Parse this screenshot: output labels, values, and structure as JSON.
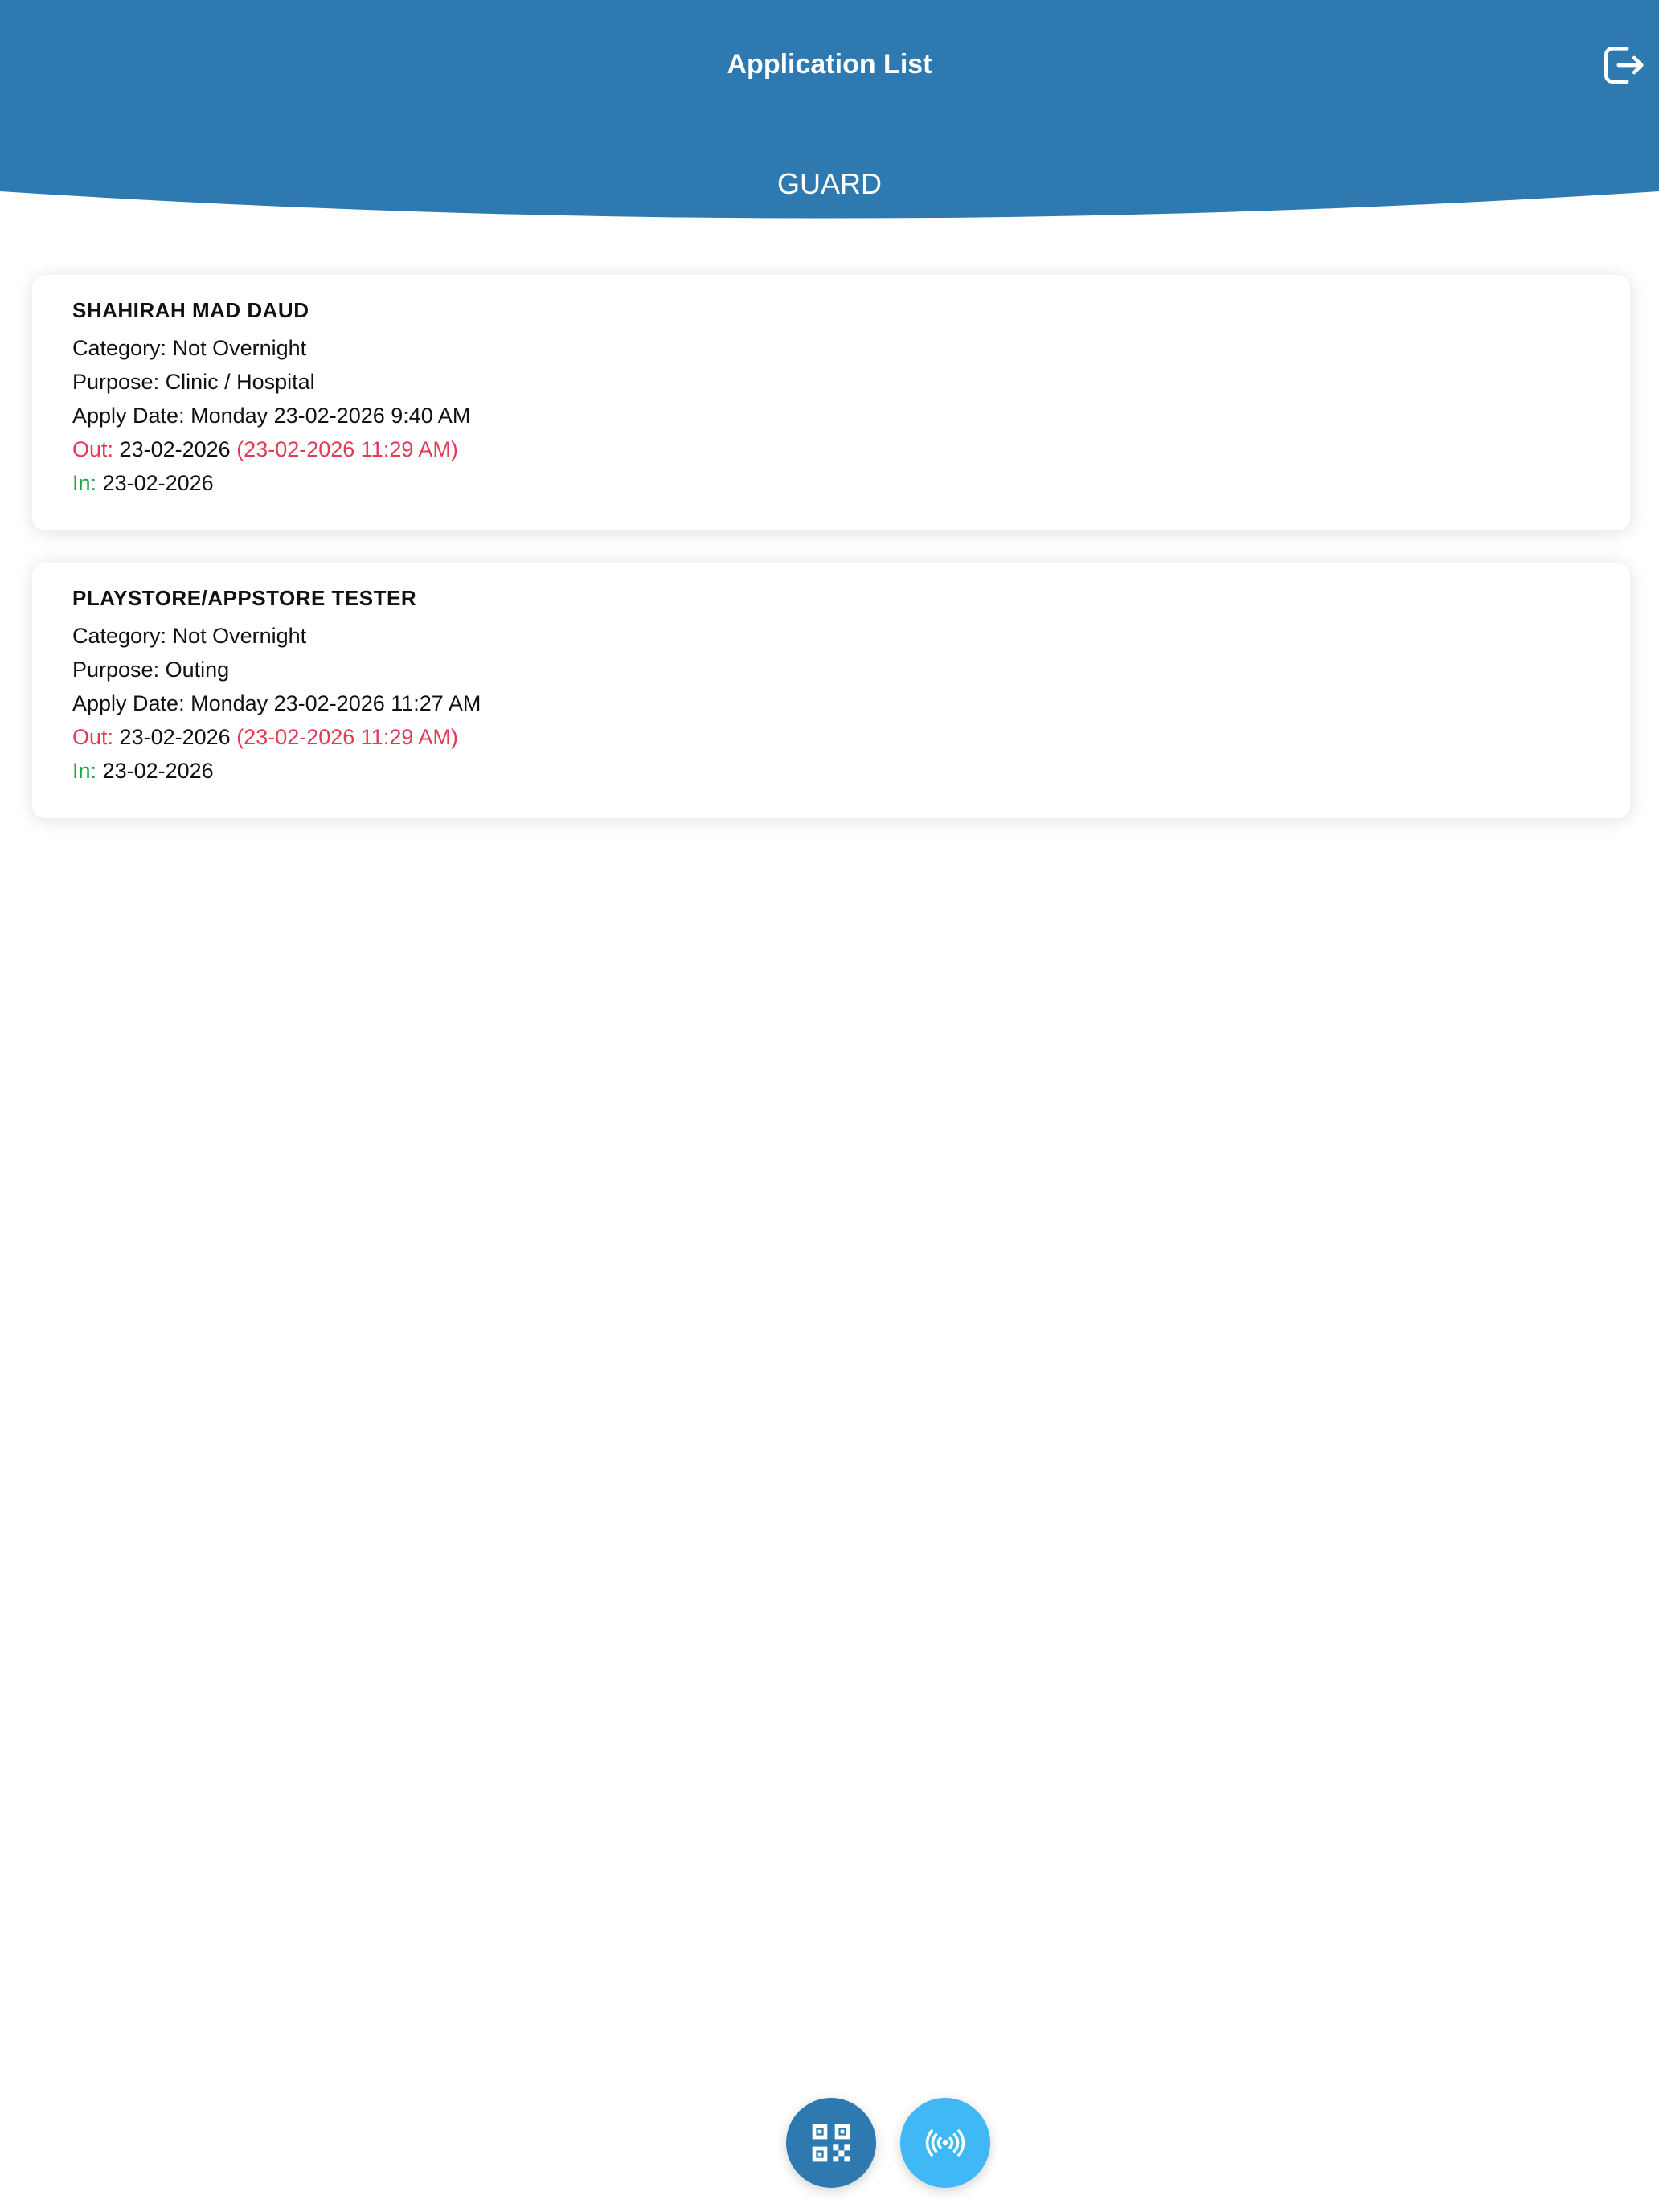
{
  "header": {
    "title": "Application List",
    "subtitle": "GUARD",
    "logout_icon": "logout-icon"
  },
  "colors": {
    "header": "#2e7ab0",
    "out": "#e03a55",
    "in": "#16a34a",
    "fab_qr": "#2e7ab0",
    "fab_nfc": "#3fb8f5"
  },
  "applications": [
    {
      "name": "SHAHIRAH MAD DAUD",
      "category": "Category: Not Overnight",
      "purpose": "Purpose: Clinic / Hospital",
      "apply_date": "Apply Date: Monday 23-02-2026 9:40 AM",
      "out_label": "Out:",
      "out_date": "23-02-2026",
      "out_actual": "(23-02-2026 11:29 AM)",
      "in_label": "In:",
      "in_date": "23-02-2026"
    },
    {
      "name": "PLAYSTORE/APPSTORE TESTER",
      "category": "Category: Not Overnight",
      "purpose": "Purpose: Outing",
      "apply_date": "Apply Date: Monday 23-02-2026 11:27 AM",
      "out_label": "Out:",
      "out_date": "23-02-2026",
      "out_actual": "(23-02-2026 11:29 AM)",
      "in_label": "In:",
      "in_date": "23-02-2026"
    }
  ],
  "fabs": {
    "qr_icon": "qr-code-icon",
    "nfc_icon": "nfc-signal-icon"
  }
}
